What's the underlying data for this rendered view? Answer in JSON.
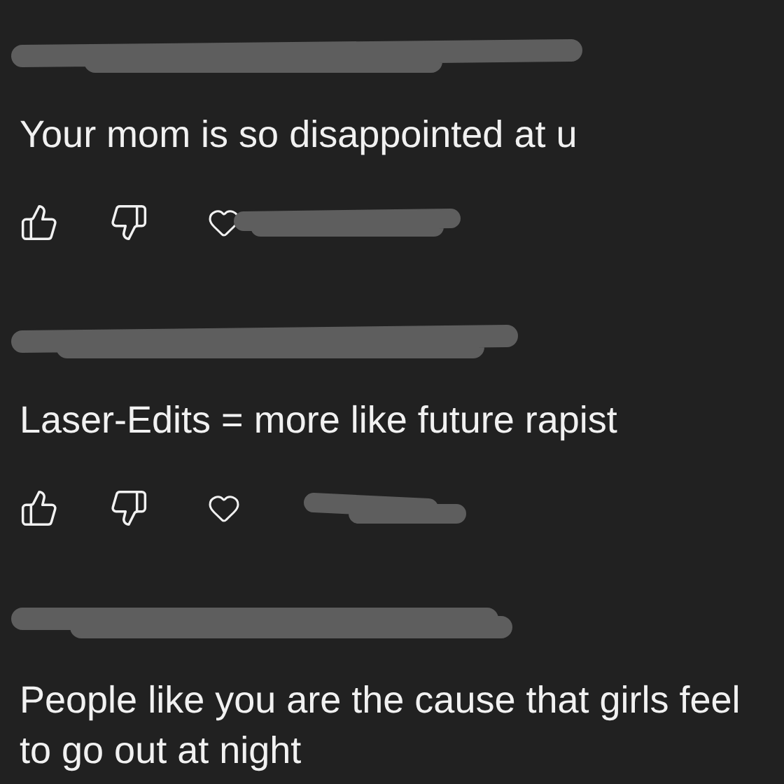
{
  "comments": [
    {
      "text": "Your mom is so disappointed at u",
      "show_actions": true
    },
    {
      "text": "Laser-Edits = more like future rapist",
      "show_actions": true
    },
    {
      "text": "People like you are the cause that girls feel to go out at night",
      "show_actions": false
    }
  ]
}
